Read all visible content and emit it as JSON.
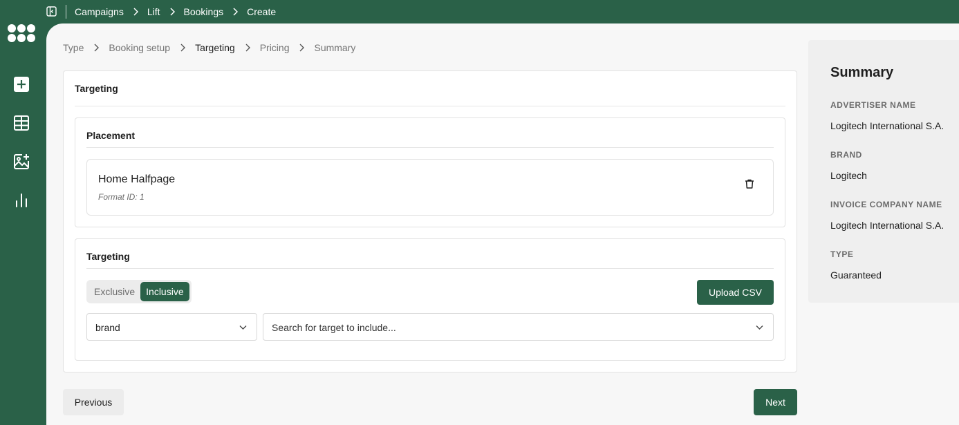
{
  "topbar": {
    "breadcrumbs": [
      "Campaigns",
      "Lift",
      "Bookings",
      "Create"
    ]
  },
  "rail": {
    "icons": [
      "add-icon",
      "table-icon",
      "add-image-icon",
      "bar-chart-icon"
    ]
  },
  "steps": [
    {
      "label": "Type",
      "active": false
    },
    {
      "label": "Booking setup",
      "active": false
    },
    {
      "label": "Targeting",
      "active": true
    },
    {
      "label": "Pricing",
      "active": false
    },
    {
      "label": "Summary",
      "active": false
    }
  ],
  "card": {
    "title": "Targeting",
    "placement": {
      "title": "Placement",
      "item": {
        "name": "Home Halfpage",
        "format": "Format ID: 1"
      }
    },
    "targeting": {
      "title": "Targeting",
      "toggle": {
        "options": [
          "Exclusive",
          "Inclusive"
        ],
        "selected": "Inclusive"
      },
      "upload_label": "Upload CSV",
      "type_select": "brand",
      "search_placeholder": "Search for target to include..."
    }
  },
  "footer": {
    "previous_label": "Previous",
    "next_label": "Next"
  },
  "summary": {
    "title": "Summary",
    "fields": [
      {
        "label": "ADVERTISER NAME",
        "value": "Logitech International S.A."
      },
      {
        "label": "BRAND",
        "value": "Logitech"
      },
      {
        "label": "INVOICE COMPANY NAME",
        "value": "Logitech International S.A."
      },
      {
        "label": "TYPE",
        "value": "Guaranteed"
      }
    ]
  },
  "colors": {
    "brand": "#2a6148",
    "surface": "#f7f7f7"
  }
}
